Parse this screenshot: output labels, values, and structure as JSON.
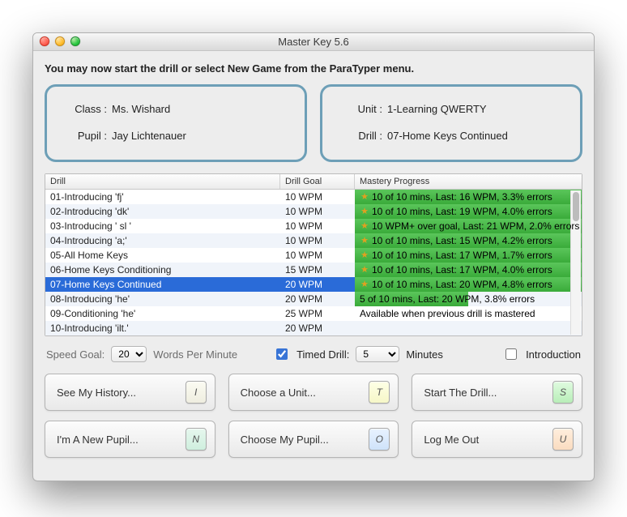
{
  "window": {
    "title": "Master Key 5.6"
  },
  "instruction": "You may now start the drill or select New Game from the ParaTyper menu.",
  "info": {
    "class_label": "Class :",
    "class_value": "Ms. Wishard",
    "pupil_label": "Pupil :",
    "pupil_value": "Jay Lichtenauer",
    "unit_label": "Unit :",
    "unit_value": "1-Learning QWERTY",
    "drill_label": "Drill :",
    "drill_value": "07-Home Keys Continued"
  },
  "table": {
    "headers": {
      "drill": "Drill",
      "goal": "Drill Goal",
      "progress": "Mastery Progress"
    },
    "rows": [
      {
        "name": "01-Introducing 'fj'",
        "goal": "10 WPM",
        "star": true,
        "fill": 100,
        "progress": "10 of 10 mins, Last: 16 WPM, 3.3% errors"
      },
      {
        "name": "02-Introducing 'dk'",
        "goal": "10 WPM",
        "star": true,
        "fill": 100,
        "progress": "10 of 10 mins, Last: 19 WPM, 4.0% errors"
      },
      {
        "name": "03-Introducing ' sl '",
        "goal": "10 WPM",
        "star": true,
        "fill": 100,
        "progress": "10 WPM+ over goal, Last: 21 WPM, 2.0% errors"
      },
      {
        "name": "04-Introducing 'a;'",
        "goal": "10 WPM",
        "star": true,
        "fill": 100,
        "progress": "10 of 10 mins, Last: 15 WPM, 4.2% errors"
      },
      {
        "name": "05-All Home Keys",
        "goal": "10 WPM",
        "star": true,
        "fill": 100,
        "progress": "10 of 10 mins, Last: 17 WPM, 1.7% errors"
      },
      {
        "name": "06-Home Keys Conditioning",
        "goal": "15 WPM",
        "star": true,
        "fill": 100,
        "progress": "10 of 10 mins, Last: 17 WPM, 4.0% errors"
      },
      {
        "name": "07-Home Keys Continued",
        "goal": "20 WPM",
        "star": true,
        "fill": 100,
        "progress": "10 of 10 mins, Last: 20 WPM, 4.8% errors",
        "selected": true
      },
      {
        "name": "08-Introducing 'he'",
        "goal": "20 WPM",
        "star": false,
        "fill": 50,
        "progress": "5 of 10 mins, Last: 20 WPM, 3.8% errors"
      },
      {
        "name": "09-Conditioning 'he'",
        "goal": "25 WPM",
        "star": false,
        "fill": 0,
        "progress": "Available when previous drill is mastered"
      },
      {
        "name": "10-Introducing 'ilt.'",
        "goal": "20 WPM",
        "star": false,
        "fill": 0,
        "progress": ""
      }
    ]
  },
  "controls": {
    "speed_label": "Speed Goal:",
    "speed_value": "20",
    "speed_unit": "Words Per Minute",
    "timed_label": "Timed Drill:",
    "timed_value": "5",
    "timed_unit": "Minutes",
    "intro_label": "Introduction"
  },
  "buttons": {
    "history": "See My History...",
    "unit": "Choose a Unit...",
    "start": "Start The Drill...",
    "newpupil": "I'm A New Pupil...",
    "choosepupil": "Choose My Pupil...",
    "logout": "Log Me Out",
    "keys": {
      "history": "I",
      "unit": "T",
      "start": "S",
      "newpupil": "N",
      "choosepupil": "O",
      "logout": "U"
    }
  }
}
